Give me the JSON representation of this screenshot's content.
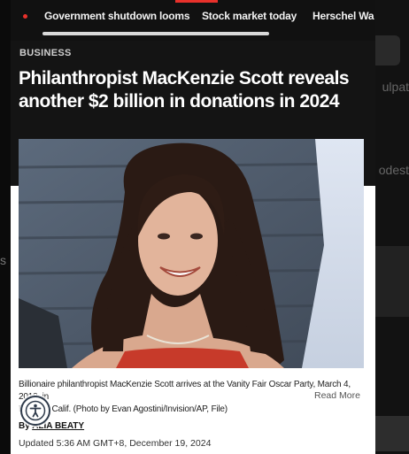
{
  "trending": {
    "items": [
      "Government shutdown looms",
      "Stock market today",
      "Herschel Wa"
    ]
  },
  "article": {
    "category": "BUSINESS",
    "headline": "Philanthropist MacKenzie Scott reveals another $2 billion in donations in 2024",
    "caption_line1": "Billionaire philanthropist MacKenzie Scott arrives at the Vanity Fair Oscar Party, March 4, 2018, in",
    "caption_line2": "Be      Hills, Calif. (Photo by Evan Agostini/Invision/AP, File)",
    "read_more": "Read More",
    "byline_prefix": "By ",
    "byline_author": "ALIA BEATY",
    "updated": "Updated 5:36 AM GMT+8, December 19, 2024"
  },
  "backdrop": {
    "text1": "ulpat",
    "text2": "odest",
    "text3": "s"
  },
  "colors": {
    "accent": "#e8312b",
    "dark_bg": "#141414",
    "headline": "#ffffff"
  },
  "icons": {
    "accessibility": "accessibility-icon"
  }
}
